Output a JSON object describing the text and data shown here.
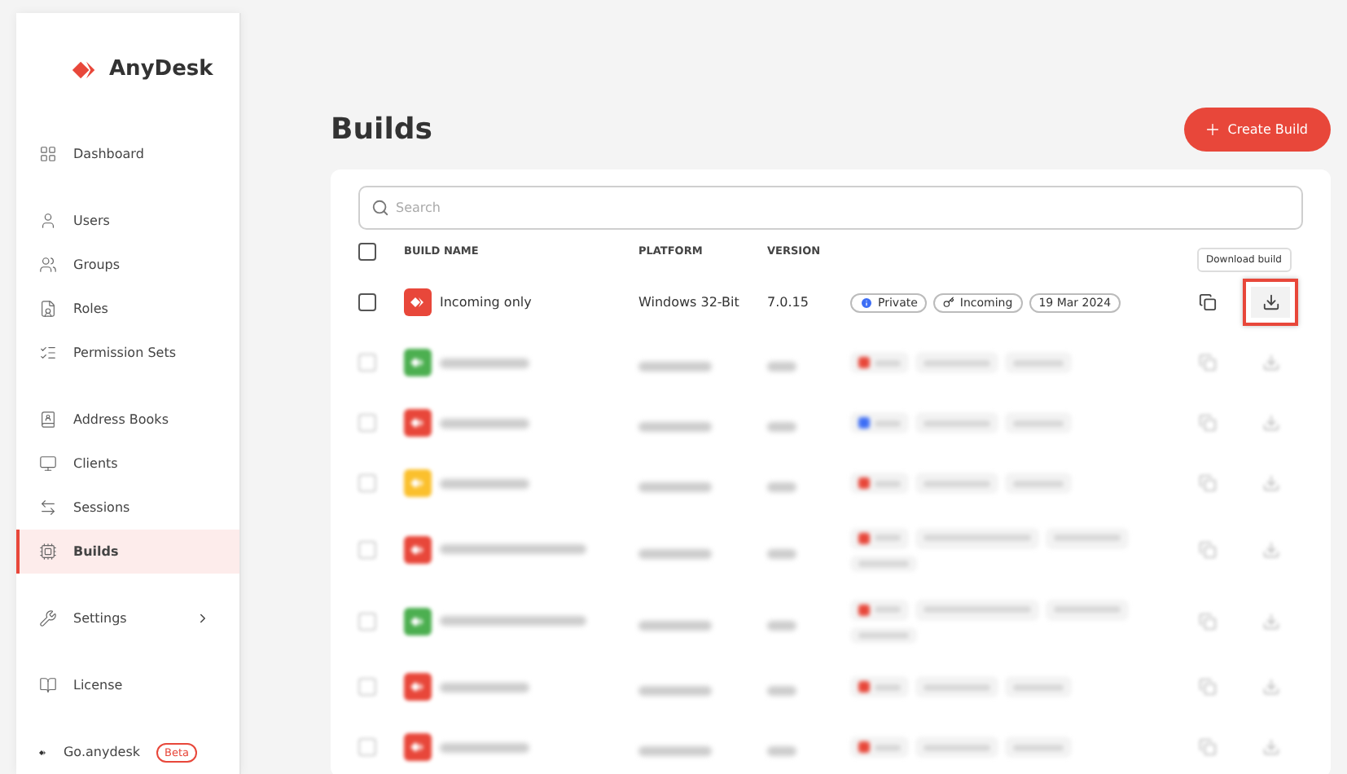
{
  "sidebar": {
    "logo": "AnyDesk",
    "sections": [
      [
        {
          "label": "Dashboard",
          "selected": false
        }
      ],
      [
        {
          "label": "Users",
          "selected": false
        },
        {
          "label": "Groups",
          "selected": false
        },
        {
          "label": "Roles",
          "selected": false
        },
        {
          "label": "Permission Sets",
          "selected": false
        }
      ],
      [
        {
          "label": "Address Books",
          "selected": false
        },
        {
          "label": "Clients",
          "selected": false
        },
        {
          "label": "Sessions",
          "selected": false
        },
        {
          "label": "Builds",
          "selected": true
        }
      ],
      [
        {
          "label": "Settings",
          "selected": false,
          "expandable": true
        }
      ],
      [
        {
          "label": "License",
          "selected": false
        }
      ],
      [
        {
          "label": "Go.anydesk",
          "selected": false,
          "badge": "Beta"
        }
      ]
    ]
  },
  "page": {
    "title": "Builds",
    "create_button": "Create Build"
  },
  "search": {
    "placeholder": "Search"
  },
  "table": {
    "select_all_checked": false,
    "columns": [
      "BUILD NAME",
      "PLATFORM",
      "VERSION"
    ],
    "rows": [
      {
        "kind": "clear",
        "name": "Incoming only",
        "platform": "Windows 32-Bit",
        "version": "7.0.15",
        "color": "#e8473a",
        "checked": false,
        "tags": [
          {
            "kind": "private",
            "label": "Private"
          },
          {
            "kind": "mode",
            "label": "Incoming"
          },
          {
            "kind": "date",
            "label": "19 Mar 2024"
          }
        ],
        "tooltip": "Download build",
        "highlighted": true
      },
      {
        "kind": "blurred",
        "checked": false,
        "color": "#4caf50",
        "tags": [
          {
            "kind": "status",
            "color": "#e8473a"
          },
          {
            "kind": "mode"
          },
          {
            "kind": "date"
          }
        ]
      },
      {
        "kind": "blurred",
        "checked": false,
        "color": "#e8473a",
        "tags": [
          {
            "kind": "status",
            "color": "#3d6ef5"
          },
          {
            "kind": "mode"
          },
          {
            "kind": "date"
          }
        ]
      },
      {
        "kind": "blurred",
        "checked": false,
        "color": "#fbc02d",
        "tags": [
          {
            "kind": "status",
            "color": "#e8473a"
          },
          {
            "kind": "mode"
          },
          {
            "kind": "date"
          }
        ]
      },
      {
        "kind": "blurred",
        "checked": false,
        "color": "#e8473a",
        "tags": [
          {
            "kind": "status",
            "color": "#e8473a"
          },
          {
            "kind": "access"
          },
          {
            "kind": "mode"
          },
          {
            "kind": "date"
          }
        ]
      },
      {
        "kind": "blurred",
        "checked": false,
        "color": "#4caf50",
        "tags": [
          {
            "kind": "status",
            "color": "#e8473a"
          },
          {
            "kind": "access"
          },
          {
            "kind": "mode"
          },
          {
            "kind": "date"
          }
        ]
      },
      {
        "kind": "blurred",
        "checked": false,
        "color": "#e8473a",
        "tags": [
          {
            "kind": "status",
            "color": "#e8473a"
          },
          {
            "kind": "mode"
          },
          {
            "kind": "date"
          }
        ]
      },
      {
        "kind": "blurred",
        "checked": false,
        "color": "#e8473a",
        "tags": [
          {
            "kind": "status",
            "color": "#e8473a"
          },
          {
            "kind": "mode"
          },
          {
            "kind": "date"
          }
        ]
      }
    ]
  }
}
